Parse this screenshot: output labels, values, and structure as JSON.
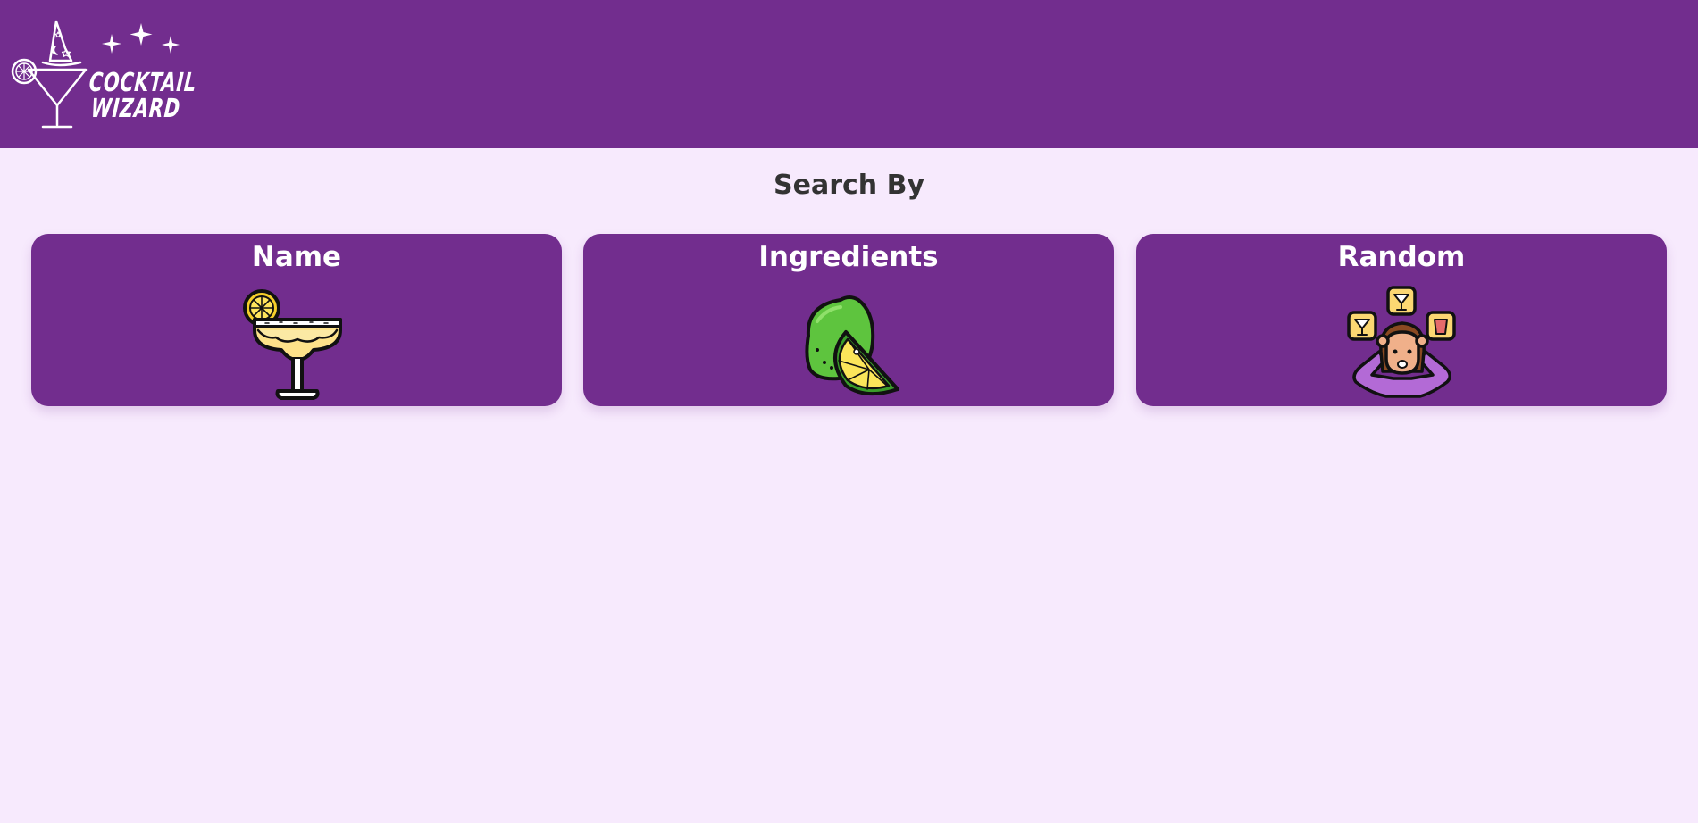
{
  "header": {
    "logo": {
      "line1": "COCKTAIL",
      "line2": "WIZARD",
      "icon": "wizard-cocktail-logo"
    }
  },
  "main": {
    "title": "Search By",
    "cards": [
      {
        "label": "Name",
        "icon": "margarita-glass-icon"
      },
      {
        "label": "Ingredients",
        "icon": "lime-icon"
      },
      {
        "label": "Random",
        "icon": "person-cocktails-icon"
      }
    ]
  },
  "colors": {
    "primary": "#722d8e",
    "background": "#f7eafd",
    "text": "#333333",
    "card_text": "#ffffff"
  }
}
